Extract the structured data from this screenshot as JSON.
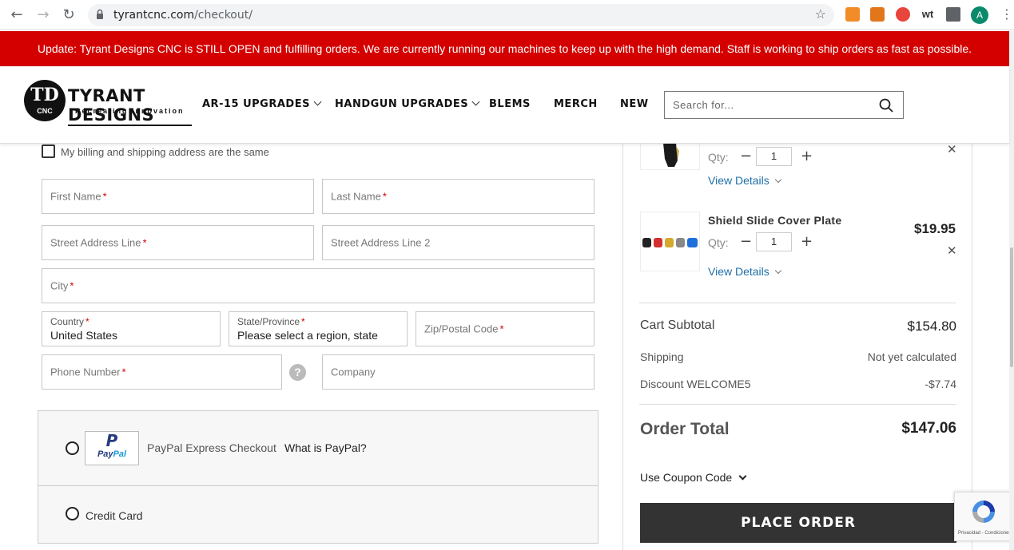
{
  "browser": {
    "url_host": "tyrantcnc.com",
    "url_path": "/checkout/",
    "avatar_initial": "A",
    "ext_wt_label": "wt"
  },
  "banner": {
    "text": "Update: Tyrant Designs CNC is STILL OPEN and fulfilling orders. We are currently running our machines to keep up with the high demand. Staff is working to ship orders as fast as possible."
  },
  "header": {
    "logo_mark": "TD",
    "logo_mark_sub": "CNC",
    "logo_title": "TYRANT DESIGNS",
    "logo_tagline": "Recreating Innovation",
    "menu": [
      {
        "label": "AR-15 UPGRADES"
      },
      {
        "label": "HANDGUN UPGRADES"
      },
      {
        "label": "BLEMS"
      },
      {
        "label": "MERCH"
      },
      {
        "label": "NEW"
      }
    ],
    "search_placeholder": "Search for..."
  },
  "billing": {
    "same_address_label": "My billing and shipping address are the same",
    "fields": {
      "first_name": "First Name",
      "last_name": "Last Name",
      "street1": "Street Address Line",
      "street2": "Street Address Line 2",
      "city": "City",
      "country_label": "Country",
      "country_value": "United States",
      "state_label": "State/Province",
      "state_value": "Please select a region, state",
      "zip": "Zip/Postal Code",
      "phone": "Phone Number",
      "company": "Company"
    },
    "required_mark": "*",
    "help_glyph": "?"
  },
  "payment": {
    "paypal_label": "PayPal Express Checkout",
    "paypal_link": "What is PayPal?",
    "paypal_logo_pay": "Pay",
    "paypal_logo_pal": "Pal",
    "paypal_logo_mark": "P",
    "credit_card_label": "Credit Card"
  },
  "cart": {
    "items": [
      {
        "name": "",
        "qty_label": "Qty:",
        "qty": "1",
        "view_details": "View Details",
        "price": ""
      },
      {
        "name": "Shield Slide Cover Plate",
        "qty_label": "Qty:",
        "qty": "1",
        "view_details": "View Details",
        "price": "$19.95"
      }
    ],
    "subtotal_label": "Cart Subtotal",
    "subtotal_value": "$154.80",
    "shipping_label": "Shipping",
    "shipping_value": "Not yet calculated",
    "discount_label": "Discount WELCOME5",
    "discount_value": "-$7.74",
    "total_label": "Order Total",
    "total_value": "$147.06",
    "coupon_label": "Use Coupon Code",
    "place_order_label": "PLACE ORDER",
    "minus_glyph": "−",
    "plus_glyph": "+",
    "remove_glyph": "✕"
  },
  "recaptcha": {
    "footer": "Privacidad - Condiciones"
  },
  "colors": {
    "banner_red": "#d40000",
    "button_dark": "#333333",
    "link_blue": "#1f6fa8"
  }
}
